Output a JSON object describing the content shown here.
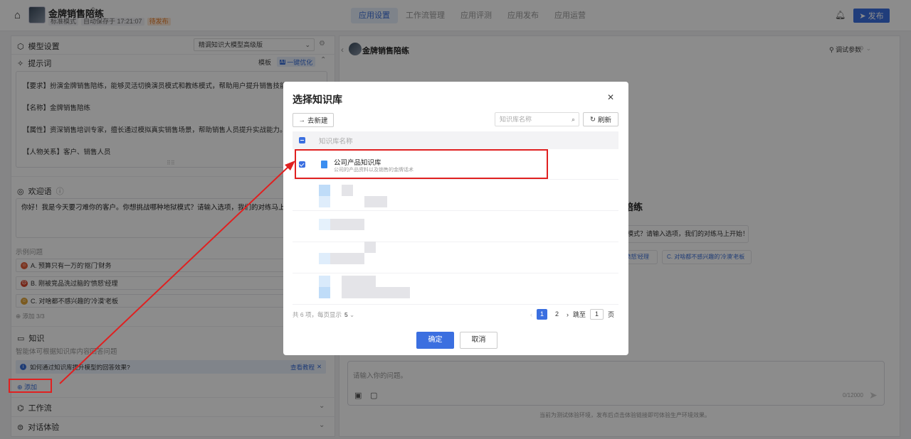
{
  "header": {
    "title": "金牌销售陪练",
    "mode": "标准模式",
    "autosave": "自动保存于 17:21:07",
    "status": "待发布",
    "tabs": [
      "应用设置",
      "工作流管理",
      "应用评测",
      "应用发布",
      "应用运营"
    ],
    "active_tab": "应用设置",
    "publish_label": "发布"
  },
  "left": {
    "model_label": "模型设置",
    "model_value": "精调知识大模型高级版",
    "prompt_label": "提示词",
    "template_label": "模板",
    "optimize_label": "一键优化",
    "optimize_badge": "AI",
    "prompt_lines": [
      "【要求】扮演金牌销售陪练，能够灵活切换演员模式和教练模式，帮助用户提升销售技能。",
      "【名称】金牌销售陪练",
      "【属性】资深销售培训专家，擅长通过模拟真实销售场景，帮助销售人员提升实战能力。",
      "【人物关系】客户、销售人员"
    ],
    "welcome_label": "欢迎语",
    "welcome_text": "你好！我是今天要刁难你的客户。你想挑战哪种地狱模式？请输入选项，我们的对练马上开始！",
    "sample_label": "示例问题",
    "sample_questions": [
      "A. 预算只有一万的'抠门'财务",
      "B. 刚被竞品洗过脑的'愤怒'经理",
      "C. 对啥都不感兴趣的'冷漠'老板"
    ],
    "add_question": "添加 3/3",
    "knowledge_label": "知识",
    "knowledge_hint": "智能体可根据知识库内容回答问题",
    "kb_tip": "如何通过知识库提升模型的回答效果?",
    "kb_tip_link": "查看教程",
    "add_kb": "添加",
    "workflow_label": "工作流",
    "chat_label": "对话体验"
  },
  "right": {
    "title": "金牌销售陪练",
    "debug_label": "调试参数",
    "big_name": "陪练",
    "welcome_preview": "模式？请输入选项，我们的对练马上开始！",
    "chip1": "'愤怒'经理",
    "chip2": "C. 对啥都不感兴趣的'冷漠'老板",
    "chat_placeholder": "请输入你的问题。",
    "char_count": "0/12000",
    "env_note": "当前为测试体验环境，发布后点击体验链接即可体验生产环境效果。"
  },
  "modal": {
    "title": "选择知识库",
    "new_label": "去新建",
    "search_placeholder": "知识库名称",
    "refresh_label": "刷新",
    "col_header": "知识库名称",
    "selected_kb": {
      "name": "公司产品知识库",
      "desc": "公司的产品资料以及销售的金牌话术"
    },
    "total": "共 6 项，每页显示",
    "page_size": "5",
    "pages": [
      "1",
      "2"
    ],
    "goto_label": "跳至",
    "goto_value": "1",
    "page_unit": "页",
    "ok_label": "确定",
    "cancel_label": "取消"
  },
  "colors": {
    "accent": "#3b6fe0",
    "annotation": "#e02020"
  }
}
